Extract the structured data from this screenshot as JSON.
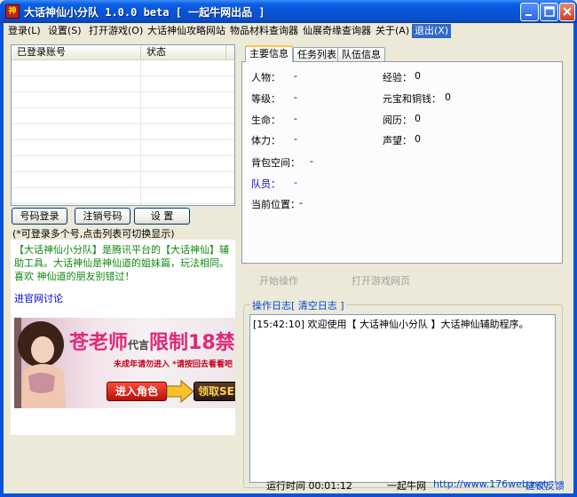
{
  "window": {
    "title": "大话神仙小分队 1.0.0 beta [ 一起牛网出品 ]",
    "icon_text": "神"
  },
  "menu": [
    {
      "label": "登录(L)"
    },
    {
      "label": "设置(S)"
    },
    {
      "label": "打开游戏(O)"
    },
    {
      "label": "大话神仙攻略网站"
    },
    {
      "label": "物品材料查询器"
    },
    {
      "label": "仙展奇缘查询器"
    },
    {
      "label": "关于(A)"
    },
    {
      "label": "退出(X)"
    }
  ],
  "accounts": {
    "col_account": "已登录账号",
    "col_status": "状态",
    "rows": []
  },
  "buttons": {
    "login": "号码登录",
    "logout": "注销号码",
    "settings": "设 置"
  },
  "hint": "(*可登录多个号,点击列表可切换显示)",
  "description": "【大话神仙小分队】是腾讯平台的【大话神仙】辅助工具。大话神仙是神仙道的姐妹篇，玩法相同。喜欢 神仙道的朋友别错过！",
  "discuss_link": "进官网讨论",
  "banner": {
    "headline_a": "苍老师",
    "headline_b": "代言",
    "headline_c": "限制18禁",
    "subline": "未成年请勿进入 *请按回去看看吧",
    "enter_label": "进入角色",
    "gift_label": "领取SEX礼包"
  },
  "tabs": [
    {
      "label": "主要信息"
    },
    {
      "label": "任务列表"
    },
    {
      "label": "队伍信息"
    }
  ],
  "info": {
    "character": {
      "label": "人物：",
      "value": "-"
    },
    "level": {
      "label": "等级：",
      "value": "-"
    },
    "hp": {
      "label": "生命：",
      "value": "-"
    },
    "stamina": {
      "label": "体力：",
      "value": "-"
    },
    "exp": {
      "label": "经验：",
      "value": "0"
    },
    "money": {
      "label": "元宝和铜钱：",
      "value": "0"
    },
    "history": {
      "label": "阅历：",
      "value": "0"
    },
    "fame": {
      "label": "声望：",
      "value": "0"
    },
    "bag": {
      "label": "背包空间：",
      "value": "-"
    },
    "members": {
      "label": "队员：",
      "value": "-"
    },
    "location": {
      "label": "当前位置：",
      "value": "-"
    }
  },
  "actions": {
    "start": "开始操作",
    "open_page": "打开游戏网页"
  },
  "log": {
    "title": "操作日志",
    "clear": "清空日志",
    "bracket_open": "[",
    "bracket_close": "]",
    "lines": [
      "[15:42:10] 欢迎使用【 大话神仙小分队 】大话神仙辅助程序。"
    ]
  },
  "status": {
    "runtime": "运行时间 00:01:12",
    "brand": "一起牛网",
    "url": "http://www.176web.net",
    "feedback": "建议反馈"
  },
  "colors": {
    "titlebar": "#0a5fe6",
    "menu_active": "#316ac5",
    "desc_green": "#118811",
    "link_blue": "#0000cc"
  }
}
